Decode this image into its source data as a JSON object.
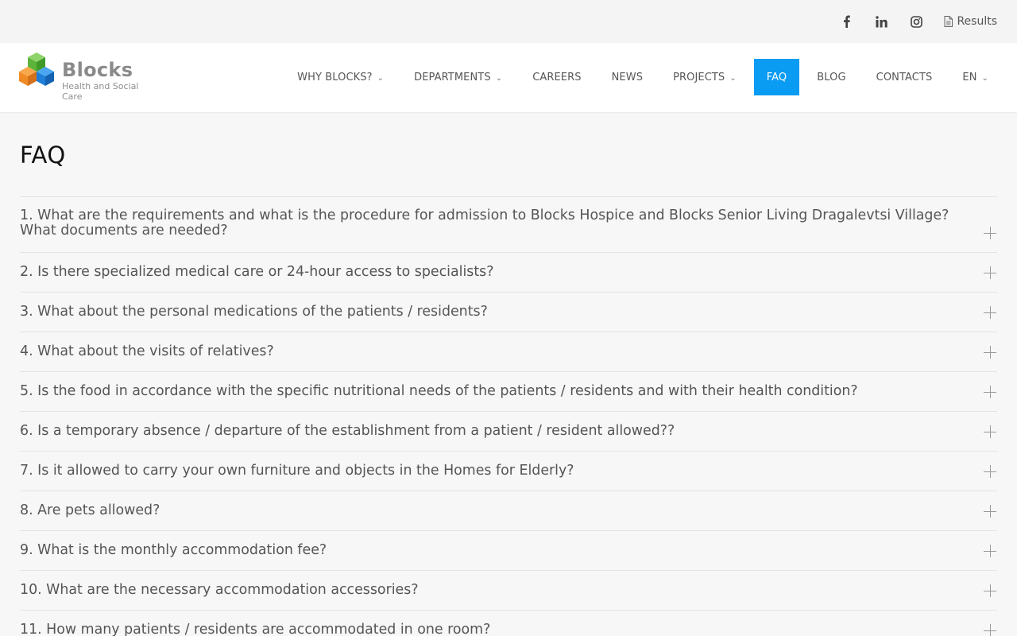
{
  "topbar": {
    "social": [
      {
        "name": "facebook-icon"
      },
      {
        "name": "linkedin-icon"
      },
      {
        "name": "instagram-icon"
      }
    ],
    "results_label": "Results"
  },
  "logo": {
    "name": "Blocks",
    "tagline": "Health and Social Care",
    "colors": {
      "green": "#6cc04a",
      "orange": "#f08a24",
      "blue": "#1f7fd8"
    }
  },
  "nav": {
    "items": [
      {
        "label": "WHY BLOCKS?",
        "dropdown": true
      },
      {
        "label": "DEPARTMENTS",
        "dropdown": true
      },
      {
        "label": "CAREERS",
        "dropdown": false
      },
      {
        "label": "NEWS",
        "dropdown": false
      },
      {
        "label": "PROJECTS",
        "dropdown": true
      },
      {
        "label": "FAQ",
        "dropdown": false,
        "active": true
      },
      {
        "label": "BLOG",
        "dropdown": false
      },
      {
        "label": "CONTACTS",
        "dropdown": false
      },
      {
        "label": "EN",
        "dropdown": true
      }
    ],
    "active_color": "#0a9bf2"
  },
  "page": {
    "title": "FAQ"
  },
  "faq": {
    "items": [
      "1. What are the requirements and what is the procedure for admission to Blocks Hospice and Blocks Senior Living Dragalevtsi Village? What documents are needed?",
      "2. Is there specialized medical care or 24-hour access to specialists?",
      "3. What about the personal medications of the patients / residents?",
      "4. What about the visits of relatives?",
      "5. Is the food in accordance with the specific nutritional needs of the patients / residents and with their health condition?",
      "6. Is a temporary absence / departure of the establishment from a patient / resident allowed??",
      "7. Is it allowed to carry your own furniture and objects in the Homes for Elderly?",
      "8. Are pets allowed?",
      "9. What is the monthly accommodation fee?",
      "10. What are the necessary accommodation accessories?",
      "11. How many patients / residents are accommodated in one room?"
    ]
  }
}
